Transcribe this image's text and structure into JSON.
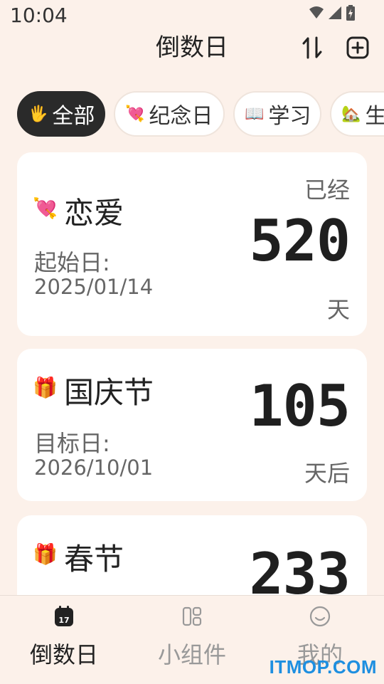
{
  "status_bar": {
    "time": "10:04",
    "icons": [
      "wifi-icon",
      "signal-icon",
      "battery-icon"
    ]
  },
  "header": {
    "title": "倒数日",
    "sort_icon": "sort-arrows-icon",
    "add_icon": "add-square-icon"
  },
  "categories": [
    {
      "emoji": "🖐",
      "label": "全部",
      "active": true
    },
    {
      "emoji": "💘",
      "label": "纪念日",
      "active": false
    },
    {
      "emoji": "📖",
      "label": "学习",
      "active": false
    },
    {
      "emoji": "🏡",
      "label": "生",
      "active": false
    }
  ],
  "events": [
    {
      "emoji": "💘",
      "title": "恋爱",
      "date_label": "起始日:",
      "date": "2025/01/14",
      "prefix": "已经",
      "count": "520",
      "unit": "天"
    },
    {
      "emoji": "🎁",
      "title": "国庆节",
      "date_label": "目标日:",
      "date": "2026/10/01",
      "prefix": "",
      "count": "105",
      "unit": "天后"
    },
    {
      "emoji": "🎁",
      "title": "春节",
      "date_label": "",
      "date": "",
      "prefix": "",
      "count": "233",
      "unit": ""
    }
  ],
  "bottom_nav": [
    {
      "label": "倒数日",
      "icon": "calendar-icon",
      "active": true
    },
    {
      "label": "小组件",
      "icon": "widgets-icon",
      "active": false
    },
    {
      "label": "我的",
      "icon": "smiley-icon",
      "active": false
    }
  ],
  "calendar_icon_day": "17",
  "watermark": "ITMOP.COM",
  "colors": {
    "background": "#fcf1ea",
    "card": "#ffffff",
    "active_chip": "#2a2a2a",
    "muted_text": "#666666",
    "watermark": "#1e8fe0"
  }
}
